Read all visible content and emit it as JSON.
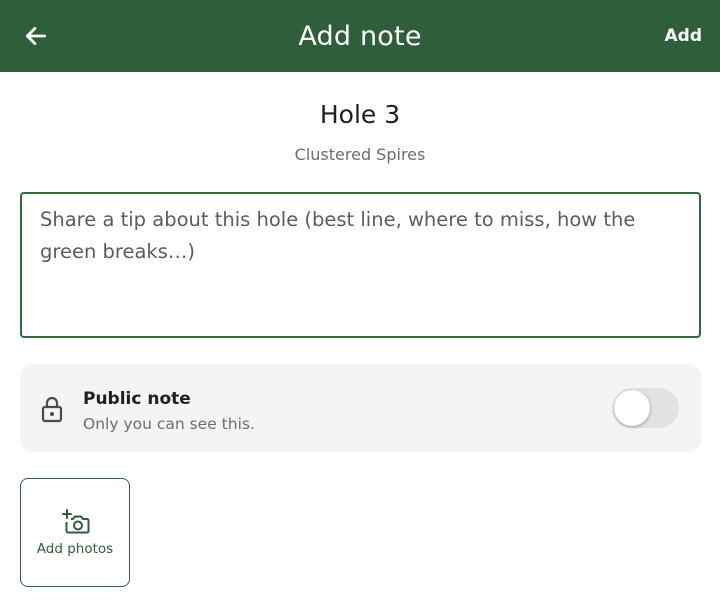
{
  "app_bar": {
    "title": "Add note",
    "action_label": "Add",
    "background_color": "#2f5e3a",
    "back_icon": "arrow-left-icon"
  },
  "hole": {
    "title": "Hole 3",
    "course_name": "Clustered Spires"
  },
  "note": {
    "value": "",
    "placeholder": "Share a tip about this hole (best line, where to miss, how the green breaks…)"
  },
  "visibility": {
    "label": "Public note",
    "description": "Only you can see this.",
    "is_public": false,
    "icon": "lock-icon"
  },
  "photos": {
    "label": "Add photos",
    "icon": "add-photo-camera-icon"
  },
  "colors": {
    "accent": "#2f6a3d",
    "card_background": "#f4f4f4",
    "toggle_off_track": "#e2e2e2"
  }
}
